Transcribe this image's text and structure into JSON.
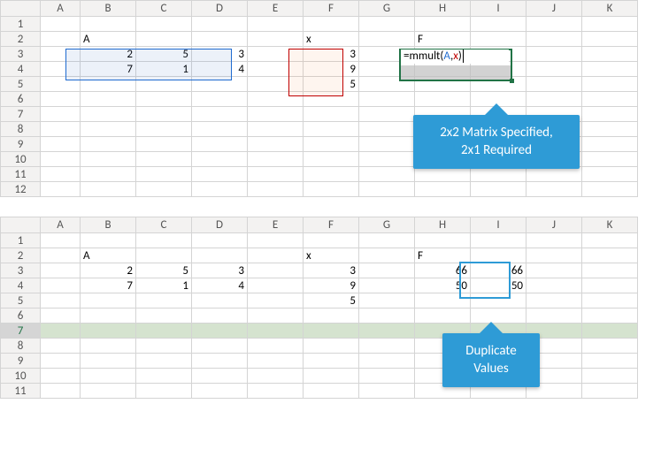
{
  "columns": [
    "A",
    "B",
    "C",
    "D",
    "E",
    "F",
    "G",
    "H",
    "I",
    "J",
    "K"
  ],
  "top": {
    "rows": [
      "1",
      "2",
      "3",
      "4",
      "5",
      "6",
      "7",
      "8",
      "9",
      "10",
      "11",
      "12"
    ],
    "labels": {
      "A": "A",
      "x": "x",
      "F": "F"
    },
    "matrixA": [
      [
        2,
        5,
        3
      ],
      [
        7,
        1,
        4
      ]
    ],
    "vecX": [
      3,
      9,
      5
    ],
    "formula": {
      "prefix": "=mmult(",
      "arg1": "A",
      "sep": ",",
      "arg2": "x",
      "suffix": ")"
    },
    "callout": {
      "line1": "2x2 Matrix Specified,",
      "line2": "2x1 Required"
    }
  },
  "bottom": {
    "rows": [
      "1",
      "2",
      "3",
      "4",
      "5",
      "6",
      "7",
      "8",
      "9",
      "10",
      "11"
    ],
    "labels": {
      "A": "A",
      "x": "x",
      "F": "F"
    },
    "matrixA": [
      [
        2,
        5,
        3
      ],
      [
        7,
        1,
        4
      ]
    ],
    "vecX": [
      3,
      9,
      5
    ],
    "resultH": [
      66,
      50
    ],
    "resultI": [
      66,
      50
    ],
    "callout": {
      "line1": "Duplicate",
      "line2": "Values"
    },
    "selectedRow": "7"
  },
  "colors": {
    "excel_green": "#217346",
    "callout": "#2e9bd6",
    "matrixA_border": "#1f6bd0",
    "vecX_border": "#c00000"
  }
}
